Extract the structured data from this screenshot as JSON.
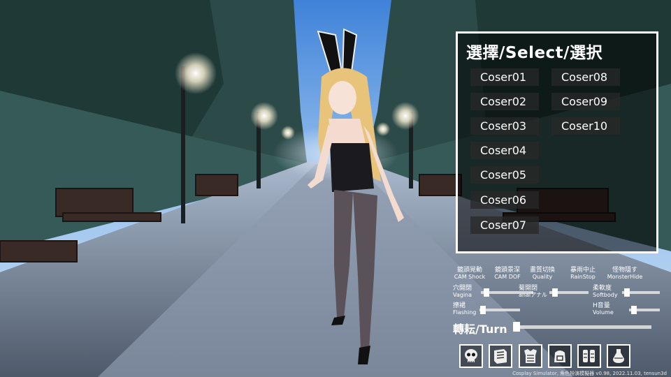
{
  "select_panel": {
    "title": "選擇/Select/選択",
    "coser_col1": [
      "Coser01",
      "Coser02",
      "Coser03",
      "Coser04",
      "Coser05",
      "Coser06",
      "Coser07"
    ],
    "coser_col2": [
      "Coser08",
      "Coser09",
      "Coser10"
    ]
  },
  "toggles": [
    {
      "zh": "鏡頭晃動",
      "en": "CAM Shock"
    },
    {
      "zh": "鏡頭景深",
      "en": "CAM DOF"
    },
    {
      "zh": "畫質切換",
      "en": "Quality"
    },
    {
      "zh": "暴雨中止",
      "en": "RainStop"
    },
    {
      "zh": "怪物隱す",
      "en": "MonsterHide"
    }
  ],
  "sliders": {
    "vagina": {
      "zh": "穴開閉",
      "en": "Vagina",
      "value": 0.1
    },
    "anal": {
      "zh": "菊開閉",
      "en": "analアナル",
      "value": 0.1
    },
    "softbody": {
      "zh": "柔軟度",
      "en": "Softbody",
      "value": 0.1
    },
    "flashing": {
      "zh": "撩裙",
      "en": "Flashing",
      "value": 0.05
    },
    "volume": {
      "zh": "H音量",
      "en": "Volume",
      "value": 0.2
    }
  },
  "turn": {
    "label": "轉耘/Turn",
    "value": 0.0
  },
  "icons": [
    "skull-icon",
    "book-icon",
    "armor-icon",
    "backpack-icon",
    "gear-set-icon",
    "potion-icon"
  ],
  "footer": "Cosplay Simulator, 角色扮演模擬器 v0.98, 2022.11.03, tensun3d"
}
